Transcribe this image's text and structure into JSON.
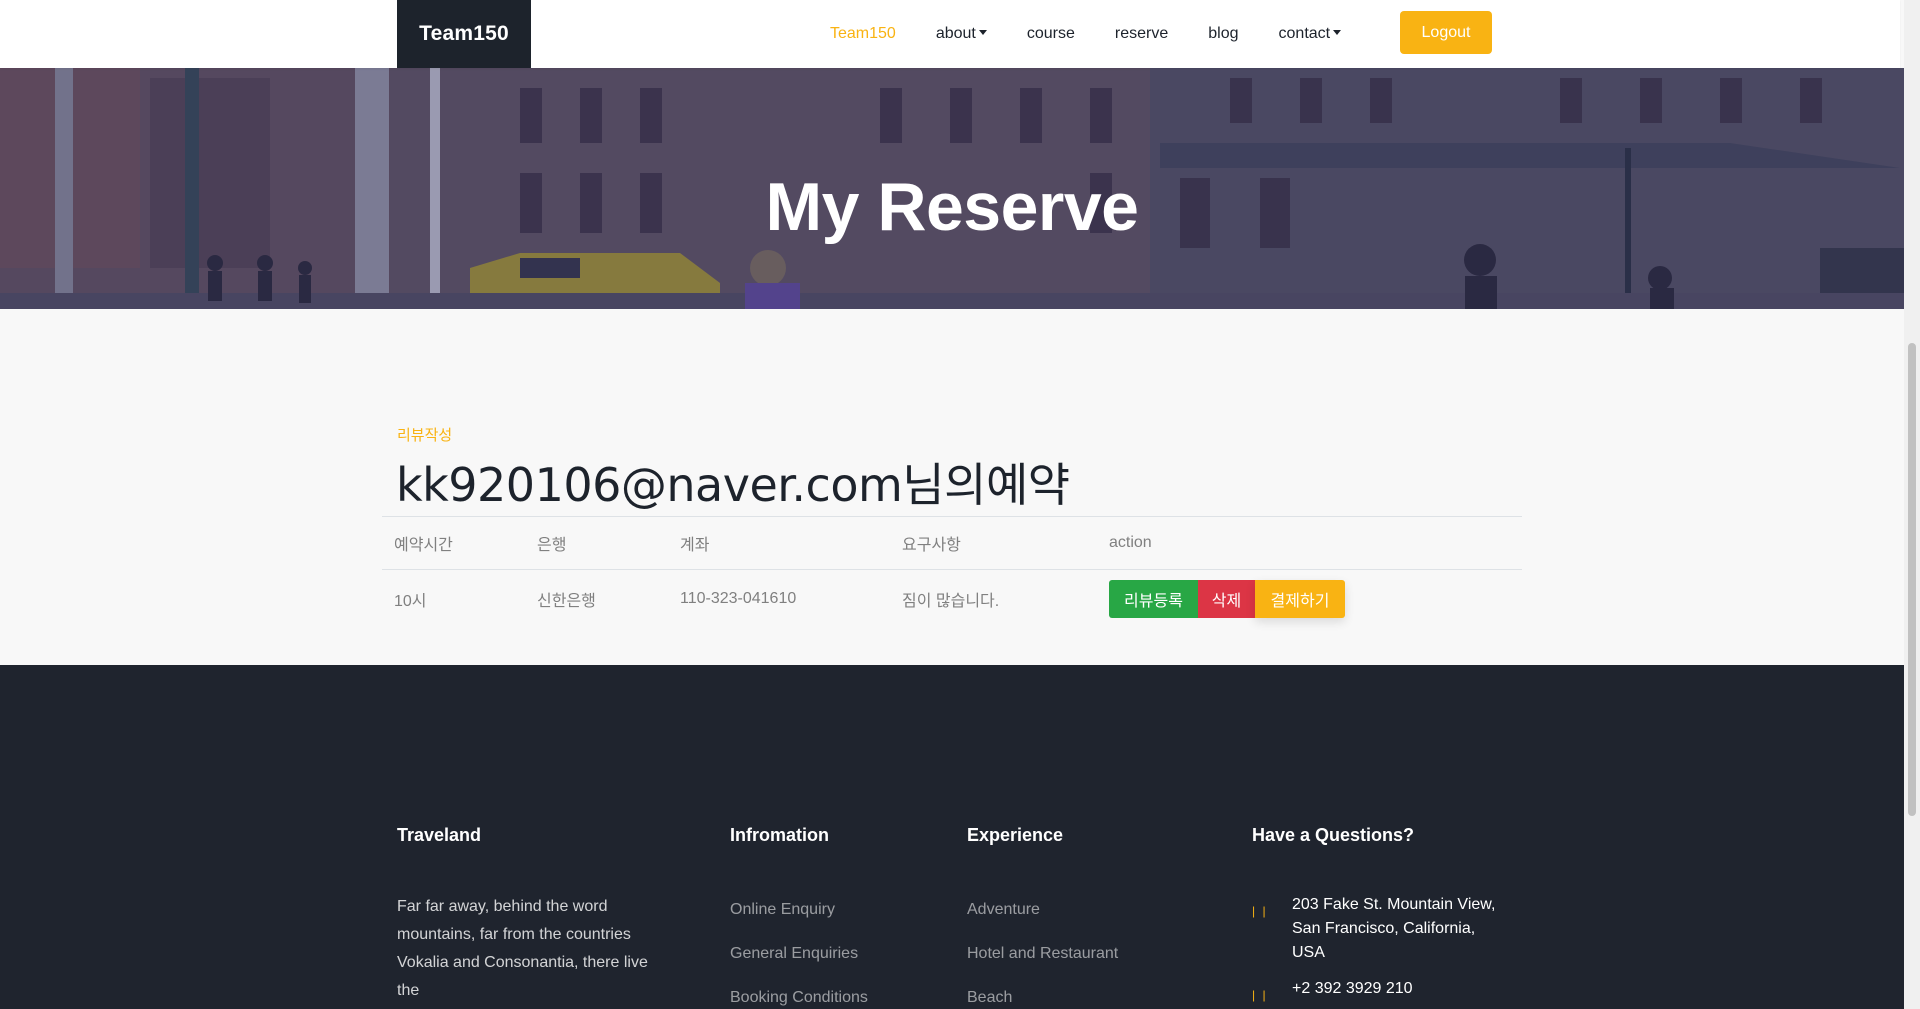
{
  "navbar": {
    "brand": "Team150",
    "links": [
      {
        "label": "Team150",
        "active": true,
        "dropdown": false
      },
      {
        "label": "about",
        "active": false,
        "dropdown": true
      },
      {
        "label": "course",
        "active": false,
        "dropdown": false
      },
      {
        "label": "reserve",
        "active": false,
        "dropdown": false
      },
      {
        "label": "blog",
        "active": false,
        "dropdown": false
      },
      {
        "label": "contact",
        "active": false,
        "dropdown": true
      }
    ],
    "logout_label": "Logout"
  },
  "hero": {
    "title": "My Reserve"
  },
  "reservation": {
    "subheading": "리뷰작성",
    "heading": "kk920106@naver.com님의예약",
    "columns": [
      "예약시간",
      "은행",
      "계좌",
      "요구사항",
      "action"
    ],
    "rows": [
      {
        "time": "10시",
        "bank": "신한은행",
        "account": "110-323-041610",
        "request": "짐이 많습니다."
      }
    ],
    "actions": {
      "review": "리뷰등록",
      "delete": "삭제",
      "pay": "결제하기"
    }
  },
  "footer": {
    "traveland": {
      "title": "Traveland",
      "text": "Far far away, behind the word mountains, far from the countries Vokalia and Consonantia, there live the"
    },
    "information": {
      "title": "Infromation",
      "links": [
        "Online Enquiry",
        "General Enquiries",
        "Booking Conditions"
      ]
    },
    "experience": {
      "title": "Experience",
      "links": [
        "Adventure",
        "Hotel and Restaurant",
        "Beach"
      ]
    },
    "questions": {
      "title": "Have a Questions?",
      "address": "203 Fake St. Mountain View, San Francisco, California, USA",
      "phone": "+2 392 3929 210"
    }
  },
  "colors": {
    "accent": "#f9b313",
    "dark": "#1d232c",
    "footer_bg": "#1f242e",
    "success": "#28a745",
    "danger": "#dc3545"
  }
}
